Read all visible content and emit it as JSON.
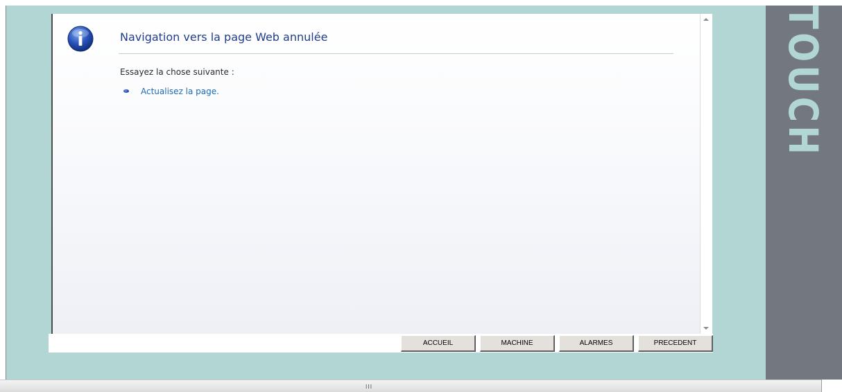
{
  "page": {
    "title": "Navigation vers la page Web annulée",
    "hint": "Essayez la chose suivante :",
    "refresh_link": "Actualisez la page."
  },
  "brand": {
    "side_text": "TOUCH"
  },
  "nav": {
    "home_label": "ACCUEIL",
    "machine_label": "MACHINE",
    "alarms_label": "ALARMES",
    "previous_label": "PRECEDENT"
  },
  "scrollbar": {
    "grip": "III"
  },
  "colors": {
    "frame": "#b1d6d4",
    "side_strip": "#737880",
    "title": "#1f3d8a",
    "link": "#1c6bb7"
  },
  "icons": {
    "info": "info-icon",
    "bullet": "bullet-icon"
  }
}
